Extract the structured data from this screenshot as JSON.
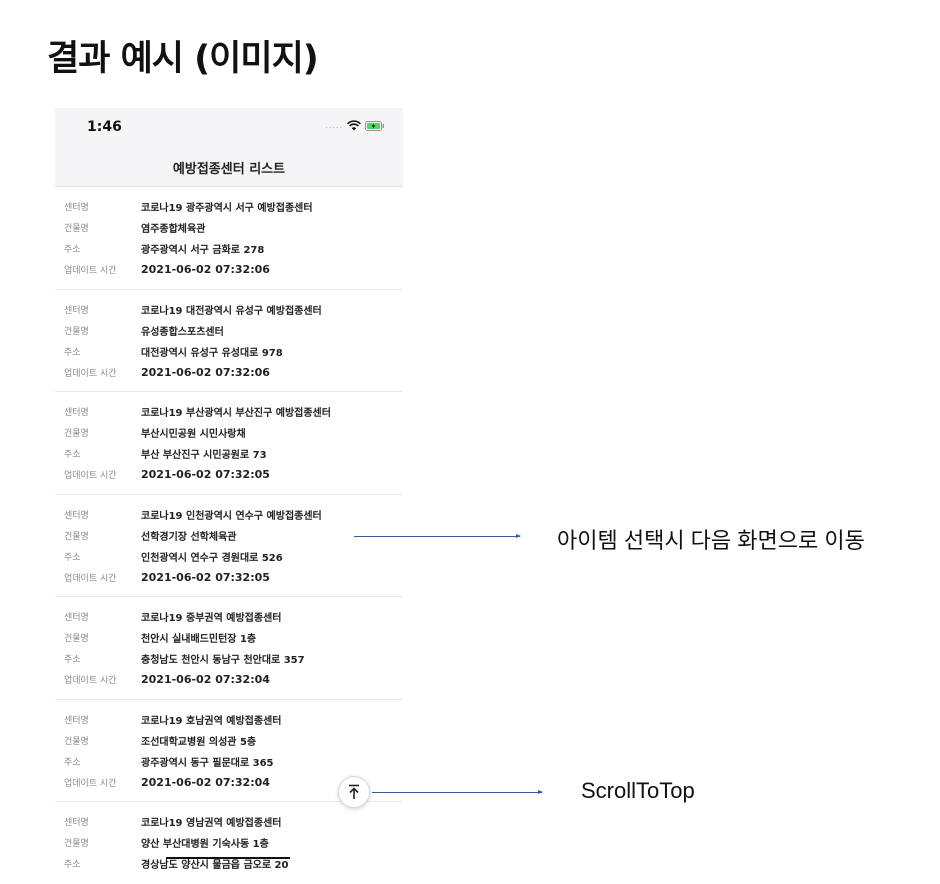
{
  "slide": {
    "title": "결과 예시 (이미지)"
  },
  "phone": {
    "status": {
      "time": "1:46",
      "signal": "....."
    },
    "nav_title": "예방접종센터 리스트",
    "labels": {
      "center": "센터명",
      "building": "건물명",
      "address": "주소",
      "updated": "업데이트 시간"
    },
    "items": [
      {
        "center": "코로나19 광주광역시 서구 예방접종센터",
        "building": "염주종합체육관",
        "address": "광주광역시 서구 금화로 278",
        "updated": "2021-06-02 07:32:06"
      },
      {
        "center": "코로나19 대전광역시 유성구 예방접종센터",
        "building": "유성종합스포츠센터",
        "address": "대전광역시 유성구 유성대로 978",
        "updated": "2021-06-02 07:32:06"
      },
      {
        "center": "코로나19 부산광역시 부산진구 예방접종센터",
        "building": "부산시민공원 시민사랑채",
        "address": "부산 부산진구 시민공원로 73",
        "updated": "2021-06-02 07:32:05"
      },
      {
        "center": "코로나19 인천광역시 연수구 예방접종센터",
        "building": "선학경기장 선학체육관",
        "address": "인천광역시 연수구 경원대로 526",
        "updated": "2021-06-02 07:32:05"
      },
      {
        "center": "코로나19 중부권역 예방접종센터",
        "building": "천안시 실내배드민턴장 1층",
        "address": "충청남도 천안시 동남구 천안대로 357",
        "updated": "2021-06-02 07:32:04"
      },
      {
        "center": "코로나19 호남권역 예방접종센터",
        "building": "조선대학교병원 의성관 5층",
        "address": "광주광역시 동구 필문대로 365",
        "updated": "2021-06-02 07:32:04"
      },
      {
        "center": "코로나19 영남권역 예방접종센터",
        "building": "양산 부산대병원 기숙사동 1층",
        "address": "경상남도 양산시 물금읍 금오로 20",
        "updated": ""
      }
    ]
  },
  "annotations": {
    "item_select": "아이템 선택시 다음 화면으로 이동",
    "scroll_to_top": "ScrollToTop"
  },
  "icons": {
    "wifi": "wifi-icon",
    "battery": "battery-charging-icon",
    "scroll_top": "arrow-up-to-line-icon"
  },
  "colors": {
    "arrow": "#3c5a9a",
    "battery": "#4cd964"
  }
}
